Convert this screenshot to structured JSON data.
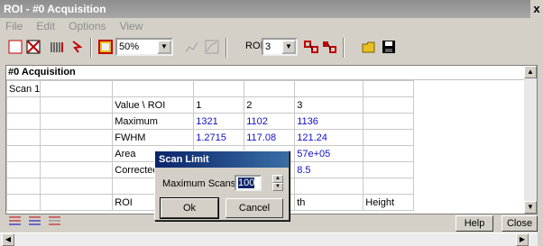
{
  "window": {
    "title": "ROI - #0  Acquisition",
    "close_glyph": "x"
  },
  "menu": [
    "File",
    "Edit",
    "Options",
    "View"
  ],
  "toolbar": {
    "icons": [
      "no-data-icon",
      "bars-icon",
      "tool-icon",
      "palette-icon"
    ],
    "zoom_value": "50%",
    "roi_label": "ROI",
    "roi_value": "3"
  },
  "grid": {
    "header": "#0  Acquisition",
    "rows": [
      [
        "Scan 1",
        "",
        "",
        "",
        "",
        "",
        ""
      ],
      [
        "",
        "",
        "Value  \\  ROI",
        "1",
        "2",
        "3",
        ""
      ],
      [
        "",
        "",
        "Maximum",
        "1321",
        "1102",
        "1136",
        ""
      ],
      [
        "",
        "",
        "FWHM",
        "1.2715",
        "117.08",
        "121.24",
        ""
      ],
      [
        "",
        "",
        "Area",
        "",
        "",
        "57e+05",
        ""
      ],
      [
        "",
        "",
        "Corrected Area",
        "",
        "",
        "8.5",
        ""
      ],
      [
        "",
        "",
        "",
        "",
        "",
        "",
        ""
      ],
      [
        "",
        "",
        "ROI",
        "",
        "",
        "th",
        "Height"
      ]
    ],
    "blue_rows": [
      2,
      3,
      4,
      5
    ]
  },
  "buttons": {
    "help": "Help",
    "close": "Close"
  },
  "dialog": {
    "title": "Scan Limit",
    "label": "Maximum Scans",
    "value": "100",
    "ok": "Ok",
    "cancel": "Cancel"
  }
}
